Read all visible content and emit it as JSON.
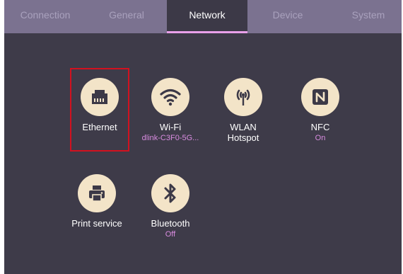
{
  "tabs": [
    {
      "label": "Connection",
      "active": false
    },
    {
      "label": "General",
      "active": false
    },
    {
      "label": "Network",
      "active": true
    },
    {
      "label": "Device",
      "active": false
    },
    {
      "label": "System",
      "active": false
    }
  ],
  "items": [
    {
      "label": "Ethernet",
      "sub": "",
      "icon": "ethernet-port-icon",
      "selected": true
    },
    {
      "label": "Wi-Fi",
      "sub": "dlink-C3F0-5G...",
      "icon": "wifi-icon"
    },
    {
      "label": "WLAN\nHotspot",
      "sub": "",
      "icon": "hotspot-icon"
    },
    {
      "label": "NFC",
      "sub": "On",
      "icon": "nfc-icon"
    },
    {
      "label": "Print service",
      "sub": "",
      "icon": "printer-icon"
    },
    {
      "label": "Bluetooth",
      "sub": "Off",
      "icon": "bluetooth-icon"
    }
  ],
  "colors": {
    "background": "#3e3b49",
    "tabbar": "#7b7290",
    "active_tab_underline": "#e9a0ea",
    "icon_circle": "#f3e4c8",
    "icon_glyph": "#3c3947",
    "subtitle": "#d98ce0",
    "selection_frame": "#d2111f"
  }
}
